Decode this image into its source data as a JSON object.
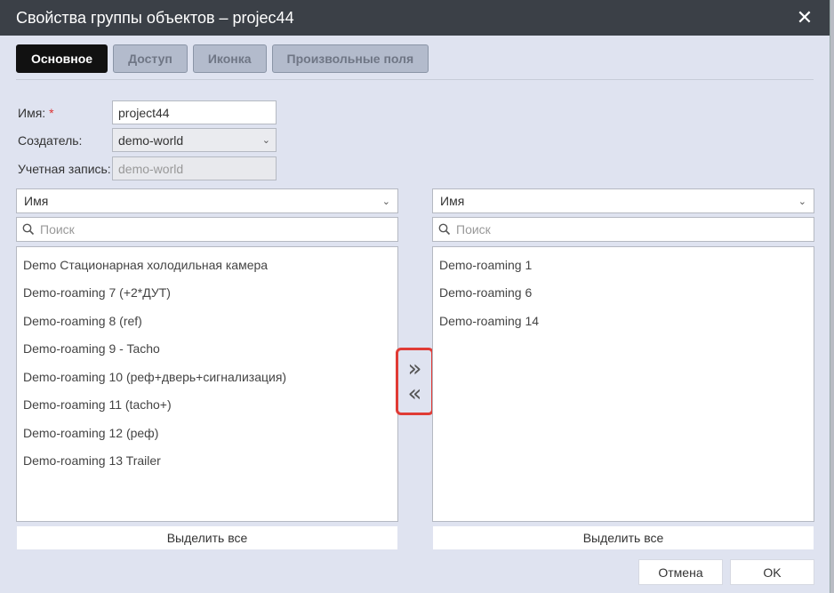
{
  "window": {
    "title": "Свойства группы объектов – projec44",
    "close_glyph": "✕"
  },
  "tabs": [
    {
      "label": "Основное",
      "active": true
    },
    {
      "label": "Доступ",
      "active": false
    },
    {
      "label": "Иконка",
      "active": false
    },
    {
      "label": "Произвольные поля",
      "active": false
    }
  ],
  "form": {
    "name_label": "Имя:",
    "name_required": "*",
    "name_value": "project44",
    "creator_label": "Создатель:",
    "creator_value": "demo-world",
    "account_label": "Учетная запись:",
    "account_value": "demo-world"
  },
  "left_panel": {
    "sort_label": "Имя",
    "search_placeholder": "Поиск",
    "items": [
      "Demo Стационарная холодильная камера",
      "Demo-roaming 7 (+2*ДУТ)",
      "Demo-roaming 8 (ref)",
      "Demo-roaming 9 - Tacho",
      "Demo-roaming 10 (реф+дверь+сигнализация)",
      "Demo-roaming 11 (tacho+)",
      "Demo-roaming 12 (реф)",
      "Demo-roaming 13 Trailer"
    ],
    "select_all_label": "Выделить все"
  },
  "right_panel": {
    "sort_label": "Имя",
    "search_placeholder": "Поиск",
    "items": [
      "Demo-roaming 1",
      "Demo-roaming 6",
      "Demo-roaming 14"
    ],
    "select_all_label": "Выделить все"
  },
  "transfer": {
    "add_glyph": "»",
    "remove_glyph": "«",
    "highlight_color": "#e03b35"
  },
  "footer": {
    "cancel_label": "Отмена",
    "ok_label": "OK"
  },
  "colors": {
    "titlebar": "#3b4047",
    "dialog_bg": "#dfe3f0",
    "active_tab": "#111111"
  },
  "icons": {
    "close": "close-icon",
    "search": "search-icon",
    "dropdown": "chevron-down-icon"
  }
}
